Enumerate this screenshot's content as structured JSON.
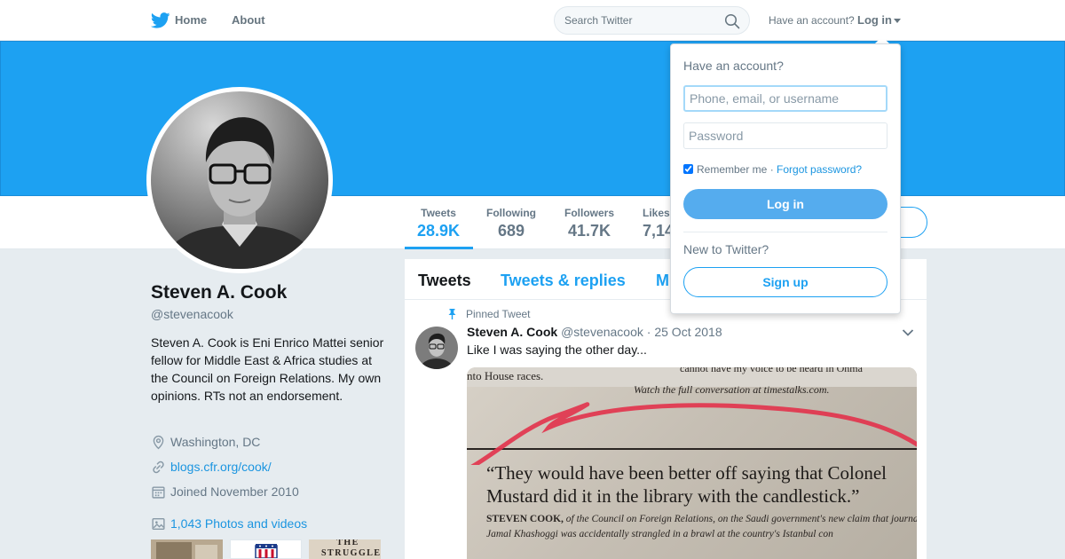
{
  "nav": {
    "home_label": "Home",
    "about_label": "About",
    "search_placeholder": "Search Twitter",
    "have_account": "Have an account?",
    "login_label": "Log in"
  },
  "colors": {
    "brand": "#1da1f2",
    "banner": "#1da1f2",
    "link": "#1b95e0",
    "login_button": "#55acee"
  },
  "stats": [
    {
      "label": "Tweets",
      "value": "28.9K"
    },
    {
      "label": "Following",
      "value": "689"
    },
    {
      "label": "Followers",
      "value": "41.7K"
    },
    {
      "label": "Likes",
      "value": "7,14"
    }
  ],
  "profile": {
    "name": "Steven A. Cook",
    "handle": "@stevenacook",
    "bio": "Steven A. Cook is Eni Enrico Mattei senior fellow for Middle East & Africa studies at the Council on Foreign Relations. My own opinions. RTs not an endorsement.",
    "location": "Washington, DC",
    "website": "blogs.cfr.org/cook/",
    "joined": "Joined November 2010",
    "media_link": "1,043 Photos and videos",
    "thumb_text": "THE STRUGGLE"
  },
  "timeline": {
    "tabs": [
      "Tweets",
      "Tweets & replies",
      "M"
    ],
    "pinned_label": "Pinned Tweet",
    "tweet": {
      "name": "Steven A. Cook",
      "handle": "@stevenacook",
      "date": "25 Oct 2018",
      "text": "Like I was saying the other day...",
      "image": {
        "top_fragment": "cannot have my voice to be heard in Ohma",
        "house_races": "nto House races.",
        "watch_line": "Watch the full conversation at timestalks.com.",
        "quote": "“They would have been better off saying that Colonel Mustard did it in the library with the candlestick.”",
        "caption_name": "STEVEN COOK,",
        "caption_text": " of the Council on Foreign Relations, on the Saudi government's new claim that journalist Jamal Khashoggi was accidentally strangled in a brawl at the country's Istanbul con"
      }
    }
  },
  "login_dropdown": {
    "title": "Have an account?",
    "username_placeholder": "Phone, email, or username",
    "password_placeholder": "Password",
    "remember_label": "Remember me",
    "separator": " · ",
    "forgot_label": "Forgot password?",
    "login_button": "Log in",
    "new_label": "New to Twitter?",
    "signup_button": "Sign up"
  }
}
